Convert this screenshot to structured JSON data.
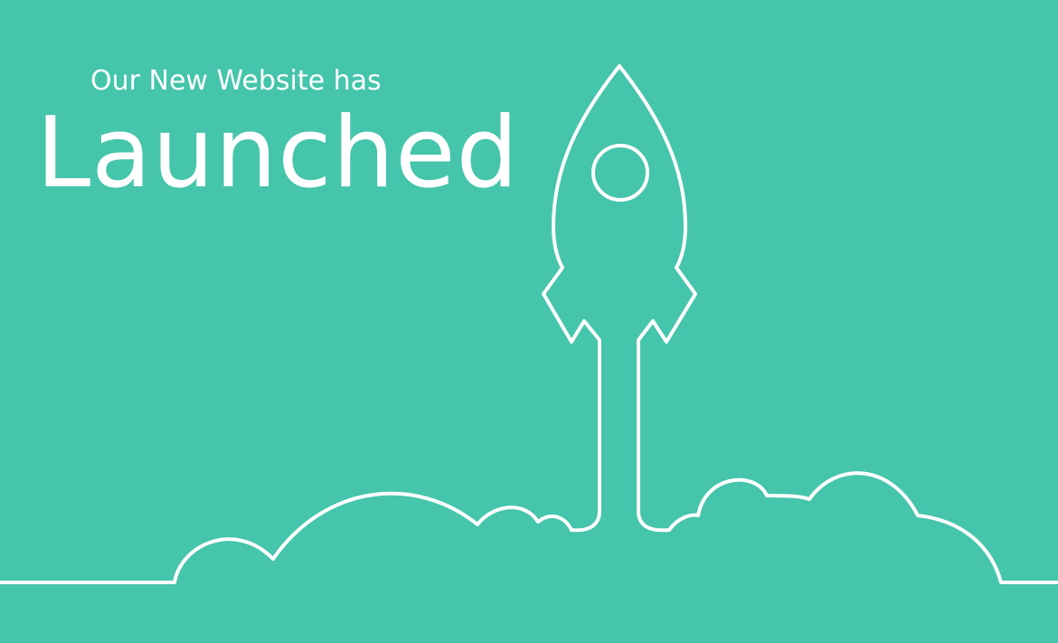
{
  "banner": {
    "subtitle": "Our New Website has",
    "title": "Launched",
    "background_color": "#45c5ab",
    "line_color": "#ffffff",
    "illustration": "rocket-launch-icon"
  }
}
